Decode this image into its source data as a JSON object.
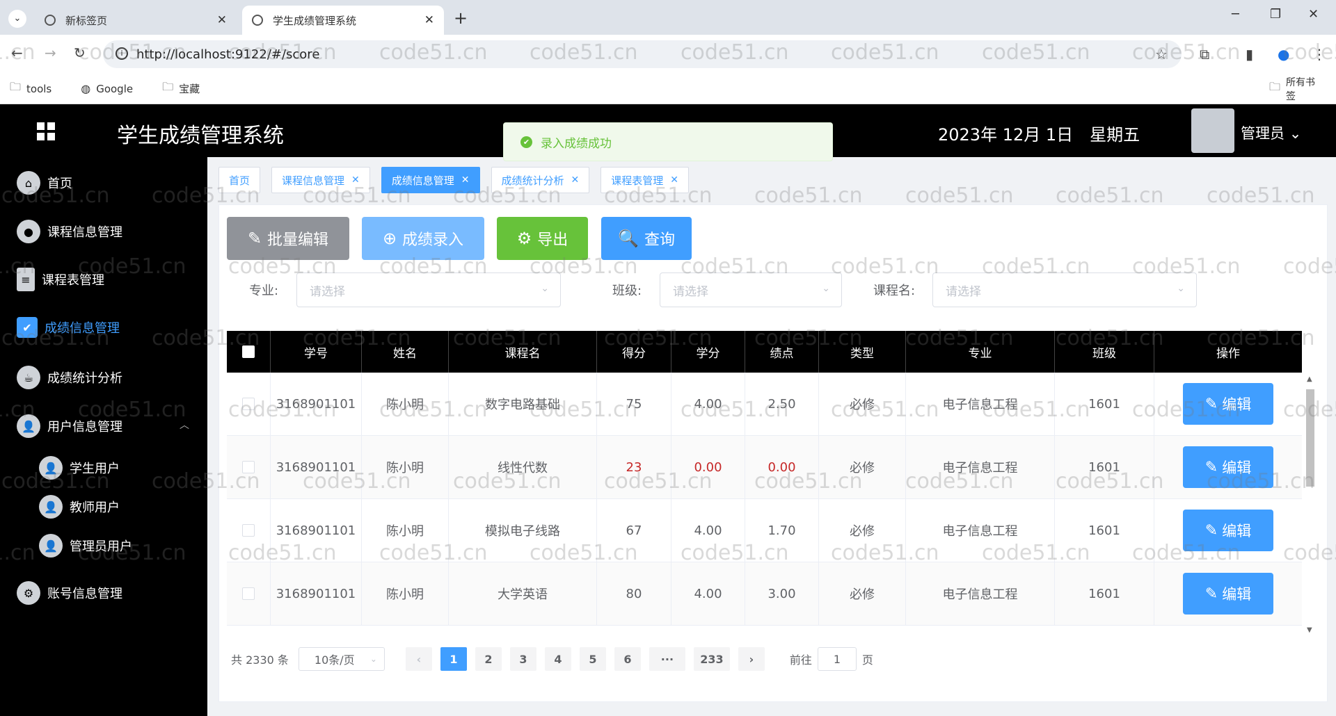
{
  "browser": {
    "tabs": [
      {
        "title": "新标签页"
      },
      {
        "title": "学生成绩管理系统"
      }
    ],
    "url": "http://localhost:9122/#/score",
    "bookmarks": [
      {
        "label": "tools"
      },
      {
        "label": "Google"
      },
      {
        "label": "宝藏"
      }
    ],
    "all_bookmarks": "所有书签"
  },
  "header": {
    "title": "学生成绩管理系统",
    "datetime": "2023年 12月 1日　星期五",
    "user": "管理员"
  },
  "toast": {
    "message": "录入成绩成功"
  },
  "sidebar": {
    "items": [
      {
        "label": "首页"
      },
      {
        "label": "课程信息管理"
      },
      {
        "label": "课程表管理"
      },
      {
        "label": "成绩信息管理"
      },
      {
        "label": "成绩统计分析"
      },
      {
        "label": "用户信息管理"
      },
      {
        "label": "学生用户"
      },
      {
        "label": "教师用户"
      },
      {
        "label": "管理员用户"
      },
      {
        "label": "账号信息管理"
      }
    ]
  },
  "tags": [
    {
      "label": "首页"
    },
    {
      "label": "课程信息管理"
    },
    {
      "label": "成绩信息管理"
    },
    {
      "label": "成绩统计分析"
    },
    {
      "label": "课程表管理"
    }
  ],
  "actions": {
    "batch_edit": "批量编辑",
    "enter_score": "成绩录入",
    "export": "导出",
    "query": "查询"
  },
  "filters": {
    "major": {
      "label": "专业:",
      "placeholder": "请选择"
    },
    "class": {
      "label": "班级:",
      "placeholder": "请选择"
    },
    "course": {
      "label": "课程名:",
      "placeholder": "请选择"
    }
  },
  "table": {
    "columns": [
      "学号",
      "姓名",
      "课程名",
      "得分",
      "学分",
      "绩点",
      "类型",
      "专业",
      "班级",
      "操作"
    ],
    "rows": [
      {
        "id": "3168901101",
        "name": "陈小明",
        "course": "数字电路基础",
        "score": "75",
        "credit": "4.00",
        "gpa": "2.50",
        "type": "必修",
        "major": "电子信息工程",
        "class": "1601",
        "fail": false
      },
      {
        "id": "3168901101",
        "name": "陈小明",
        "course": "线性代数",
        "score": "23",
        "credit": "0.00",
        "gpa": "0.00",
        "type": "必修",
        "major": "电子信息工程",
        "class": "1601",
        "fail": true
      },
      {
        "id": "3168901101",
        "name": "陈小明",
        "course": "模拟电子线路",
        "score": "67",
        "credit": "4.00",
        "gpa": "1.70",
        "type": "必修",
        "major": "电子信息工程",
        "class": "1601",
        "fail": false
      },
      {
        "id": "3168901101",
        "name": "陈小明",
        "course": "大学英语",
        "score": "80",
        "credit": "4.00",
        "gpa": "3.00",
        "type": "必修",
        "major": "电子信息工程",
        "class": "1601",
        "fail": false
      }
    ],
    "edit_label": "编辑"
  },
  "pagination": {
    "total": "共 2330 条",
    "page_size": "10条/页",
    "pages": [
      "1",
      "2",
      "3",
      "4",
      "5",
      "6",
      "···",
      "233"
    ],
    "current": "1",
    "goto_prefix": "前往",
    "goto_value": "1",
    "goto_suffix": "页"
  },
  "watermark": "code51.cn",
  "colors": {
    "primary": "#409eff",
    "success": "#67c23a",
    "danger": "#c62828",
    "gray_btn": "#909399",
    "light_btn": "#79bbff"
  }
}
